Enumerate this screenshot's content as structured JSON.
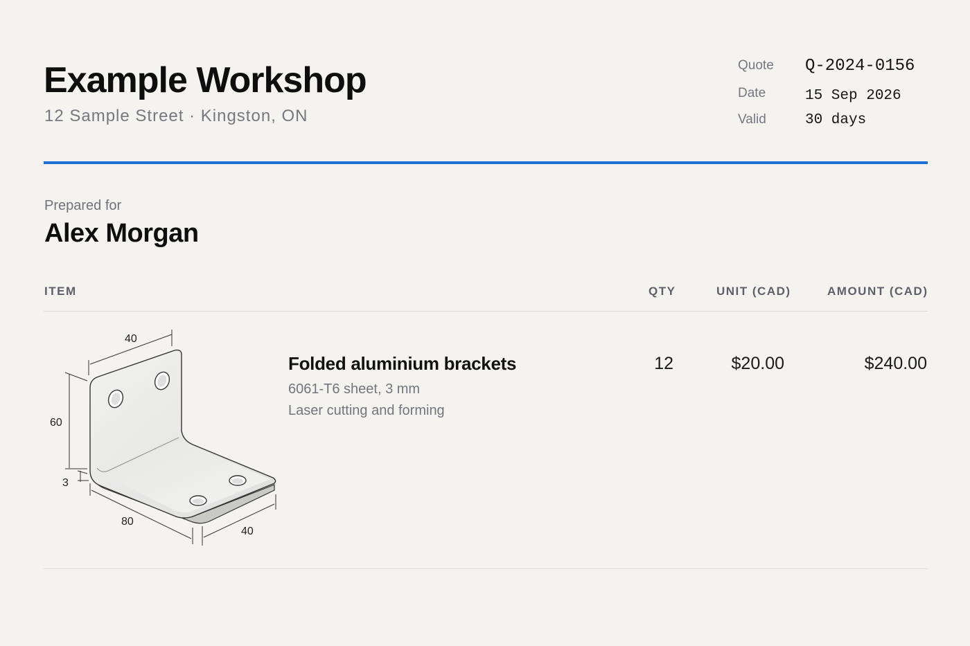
{
  "company": {
    "name": "Example Workshop",
    "address": "12 Sample Street · Kingston, ON"
  },
  "meta": {
    "quote_label": "Quote",
    "quote_value": "Q-2024-0156",
    "date_label": "Date",
    "date_value": "15 Sep 2026",
    "valid_label": "Valid",
    "valid_value": "30 days"
  },
  "accent_color": "#1f6fd6",
  "client": {
    "prepared_label": "Prepared for",
    "name": "Alex Morgan"
  },
  "table": {
    "headers": {
      "item": "ITEM",
      "qty": "QTY",
      "unit": "UNIT (CAD)",
      "amount": "AMOUNT (CAD)"
    },
    "rows": [
      {
        "title": "Folded aluminium brackets",
        "spec": "6061-T6 sheet, 3 mm",
        "process": "Laser cutting and forming",
        "qty": "12",
        "unit": "$20.00",
        "amount": "$240.00",
        "drawing": {
          "icon": "bracket-drawing-icon",
          "dims": {
            "top_width": "40",
            "height": "60",
            "thickness": "3",
            "length": "80",
            "depth": "40"
          }
        }
      }
    ]
  }
}
